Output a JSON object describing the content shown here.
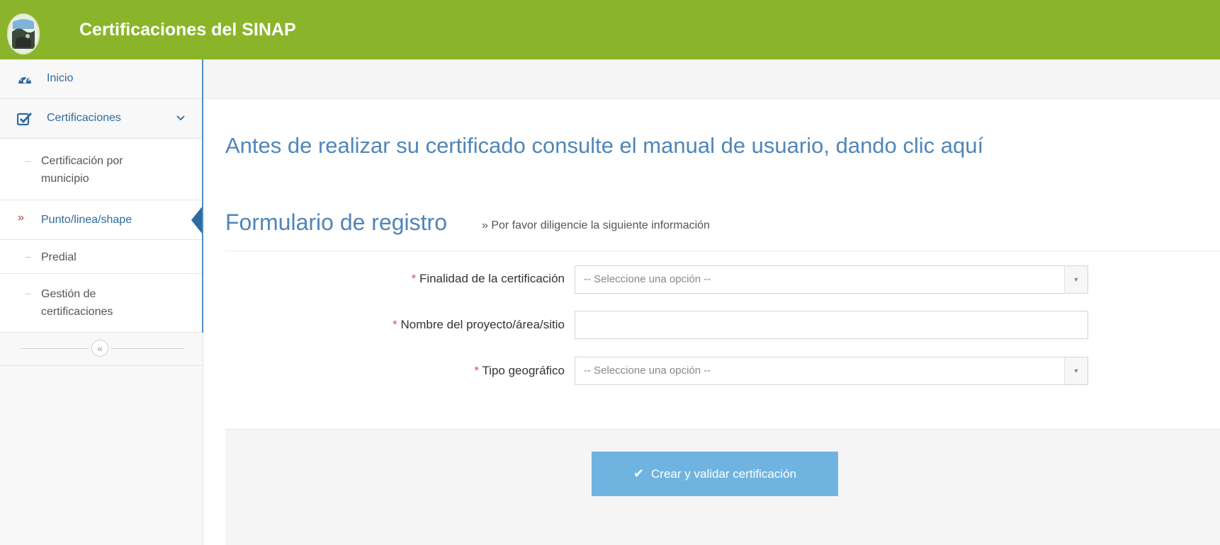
{
  "header": {
    "title": "Certificaciones del SINAP"
  },
  "sidebar": {
    "inicio": {
      "label": "Inicio",
      "icon": "dashboard-icon"
    },
    "certificaciones": {
      "label": "Certificaciones",
      "icon": "checkbox-icon"
    },
    "sub_items": [
      {
        "label": "Certificación por municipio",
        "active": false
      },
      {
        "label": "Punto/linea/shape",
        "active": true
      },
      {
        "label": "Predial",
        "active": false
      },
      {
        "label": "Gestión de certificaciones",
        "active": false
      }
    ],
    "collapse_glyph": "«"
  },
  "main": {
    "notice": "Antes de realizar su certificado consulte el manual de usuario, dando clic aquí",
    "form_title": "Formulario de registro",
    "form_subtitle": "» Por favor diligencie la siguiente información",
    "fields": {
      "finalidad": {
        "label": "Finalidad de la certificación",
        "value": "-- Seleccione una opción --"
      },
      "nombre": {
        "label": "Nombre del proyecto/área/sitio",
        "value": ""
      },
      "tipo": {
        "label": "Tipo geográfico",
        "value": "-- Seleccione una opción --"
      }
    },
    "required_mark": "*",
    "submit_label": "Crear y validar certificación"
  },
  "colors": {
    "header": "#8ab52a",
    "accent": "#2c6aa0",
    "button": "#6fb3e0"
  }
}
